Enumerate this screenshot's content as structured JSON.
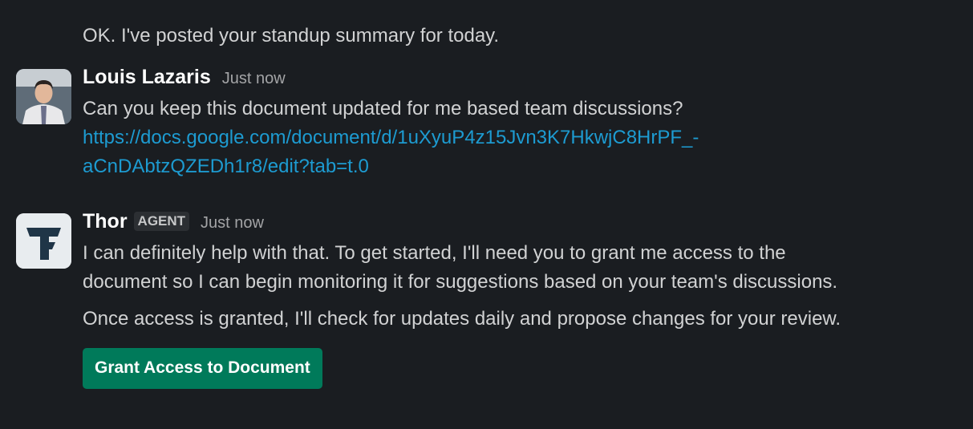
{
  "messages": [
    {
      "text": "OK. I've posted your standup summary for today."
    },
    {
      "author": "Louis Lazaris",
      "time": "Just now",
      "text": "Can you keep this document updated for me based team discussions?",
      "link_line1": "https://docs.google.com/document/d/1uXyuP4z15Jvn3K7HkwjC8HrPF_-",
      "link_line2": "aCnDAbtzQZEDh1r8/edit?tab=t.0"
    },
    {
      "author": "Thor",
      "badge": "AGENT",
      "time": "Just now",
      "para1_line1": "I can definitely help with that. To get started, I'll need you to grant me access to the",
      "para1_line2": "document so I can begin monitoring it for suggestions based on your team's discussions.",
      "para2": "Once access is granted, I'll check for updates daily and propose changes for your review.",
      "button": "Grant Access to Document"
    }
  ],
  "colors": {
    "background": "#1a1d21",
    "text": "#d1d2d3",
    "link": "#1d9bd1",
    "button": "#007a5a",
    "thor_avatar_bg": "#e8ecef",
    "thor_logo": "#1f3547"
  },
  "icons": {
    "louis_avatar": "user-photo-avatar",
    "thor_avatar": "thor-logo-icon"
  }
}
